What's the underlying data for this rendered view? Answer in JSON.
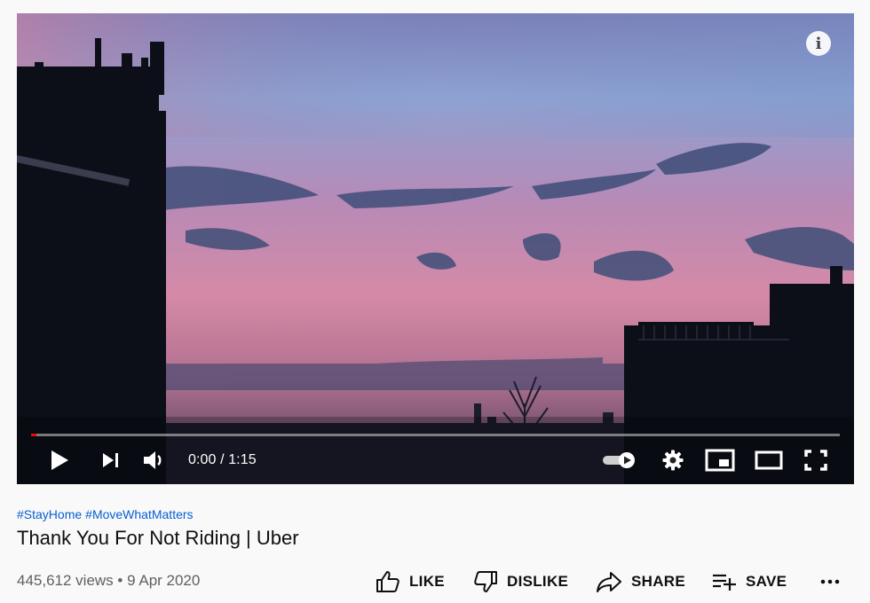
{
  "player": {
    "current_time": "0:00",
    "separator": " / ",
    "duration": "1:15",
    "progress_fraction": 0.007,
    "info_label": "i"
  },
  "video": {
    "hashtags": [
      "#StayHome",
      "#MoveWhatMatters"
    ],
    "title": "Thank You For Not Riding | Uber",
    "views": "445,612 views",
    "dot": "•",
    "date": "9 Apr 2020"
  },
  "actions": {
    "like": "LIKE",
    "dislike": "DISLIKE",
    "share": "SHARE",
    "save": "SAVE",
    "more": "more-icon"
  },
  "colors": {
    "accent": "#ff0000",
    "link": "#065fd4",
    "sky_pink": "#d27fa0",
    "sky_blue": "#6f93c8"
  }
}
